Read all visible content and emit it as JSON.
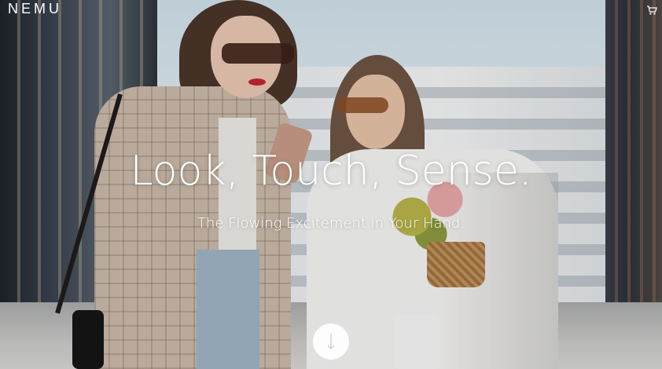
{
  "header": {
    "logo_text": "NEMU",
    "cart_icon": "cart-icon"
  },
  "hero": {
    "headline": "Look, Touch, Sense.",
    "subline": "The Flowing Excitement in Your Hand.",
    "scroll_icon": "arrow-down-icon"
  },
  "colors": {
    "text": "#ffffff",
    "scroll_button_bg": "#ffffff",
    "arrow": "#c8c8c8"
  }
}
